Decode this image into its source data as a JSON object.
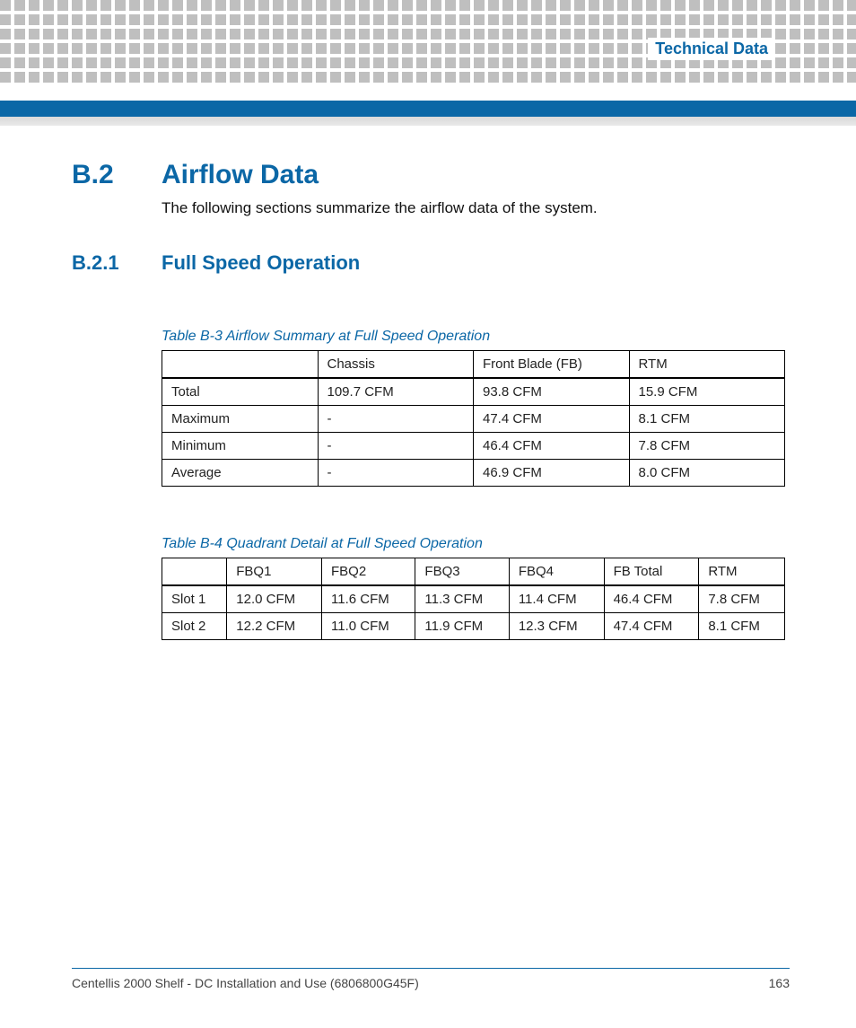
{
  "header": {
    "title": "Technical Data"
  },
  "section": {
    "number": "B.2",
    "title": "Airflow Data",
    "intro": "The following sections summarize the airflow data of the system."
  },
  "subsection": {
    "number": "B.2.1",
    "title": "Full Speed Operation"
  },
  "tableB3": {
    "caption": "Table B-3 Airflow Summary at Full Speed Operation",
    "headers": [
      "",
      "Chassis",
      "Front Blade (FB)",
      "RTM"
    ],
    "rows": [
      [
        "Total",
        "109.7 CFM",
        "93.8 CFM",
        "15.9 CFM"
      ],
      [
        "Maximum",
        "-",
        "47.4 CFM",
        "8.1 CFM"
      ],
      [
        "Minimum",
        "-",
        "46.4 CFM",
        "7.8 CFM"
      ],
      [
        "Average",
        "-",
        "46.9 CFM",
        "8.0 CFM"
      ]
    ]
  },
  "tableB4": {
    "caption": "Table B-4 Quadrant Detail at Full Speed Operation",
    "headers": [
      "",
      "FBQ1",
      "FBQ2",
      "FBQ3",
      "FBQ4",
      "FB Total",
      "RTM"
    ],
    "rows": [
      [
        "Slot 1",
        "12.0 CFM",
        "11.6 CFM",
        "11.3 CFM",
        "11.4 CFM",
        "46.4 CFM",
        "7.8 CFM"
      ],
      [
        "Slot 2",
        "12.2 CFM",
        "11.0 CFM",
        "11.9 CFM",
        "12.3 CFM",
        "47.4 CFM",
        "8.1 CFM"
      ]
    ]
  },
  "footer": {
    "doc": "Centellis 2000 Shelf - DC Installation and Use (6806800G45F)",
    "page": "163"
  }
}
